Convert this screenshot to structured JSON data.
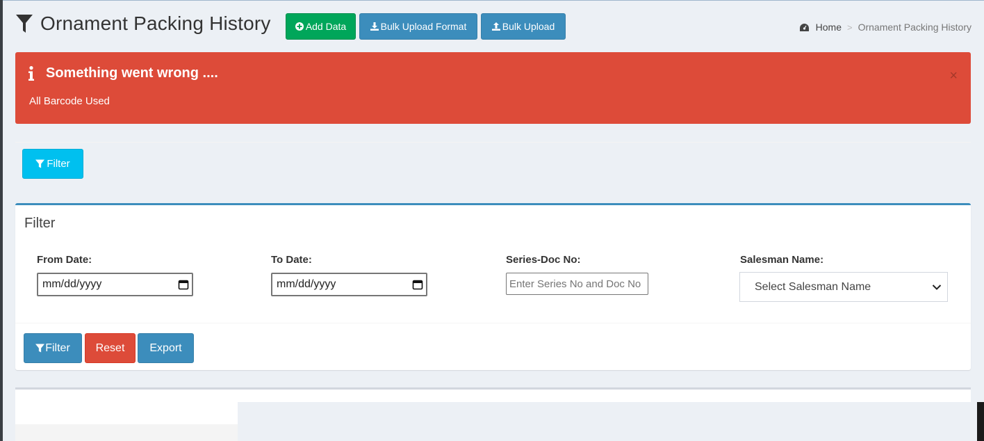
{
  "header": {
    "title": "Ornament Packing History",
    "buttons": {
      "add_data": "Add Data",
      "bulk_upload_format": "Bulk Upload Format",
      "bulk_upload": "Bulk Upload"
    },
    "breadcrumb": {
      "home": "Home",
      "separator": ">",
      "current": "Ornament Packing History"
    }
  },
  "alert": {
    "title": "Something went wrong ....",
    "message": "All Barcode Used",
    "close": "×",
    "color": "#dd4b39"
  },
  "filter_toggle": {
    "label": "Filter"
  },
  "filter_box": {
    "title": "Filter",
    "from_date": {
      "label": "From Date:",
      "value": "mm/dd/yyyy"
    },
    "to_date": {
      "label": "To Date:",
      "value": "mm/dd/yyyy"
    },
    "series_doc": {
      "label": "Series-Doc No:",
      "placeholder": "Enter Series No and Doc No"
    },
    "salesman": {
      "label": "Salesman Name:",
      "selected": "Select Salesman Name"
    },
    "buttons": {
      "filter": "Filter",
      "reset": "Reset",
      "export": "Export"
    }
  },
  "colors": {
    "primary": "#3c8dbc",
    "success": "#00a65a",
    "info": "#00c0ef",
    "danger": "#dd4b39",
    "background": "#ecf0f5"
  },
  "icons": {
    "title": "filter-icon",
    "add_data": "plus-circle-icon",
    "bulk_upload_format": "download-icon",
    "bulk_upload": "upload-icon",
    "breadcrumb_home": "dashboard-icon",
    "alert": "info-icon",
    "select": "chevron-down-icon",
    "date": "calendar-icon"
  }
}
